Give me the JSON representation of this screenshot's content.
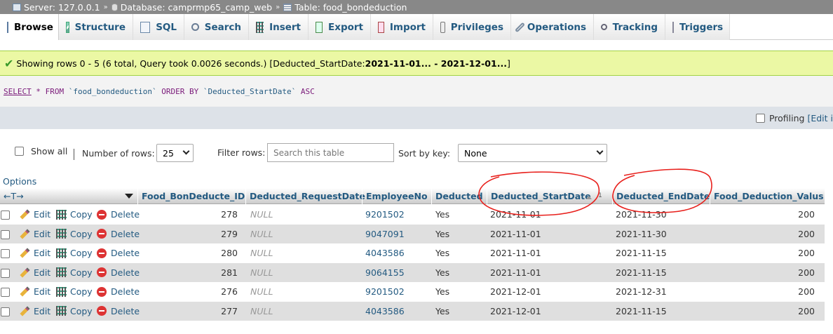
{
  "breadcrumb": {
    "server": "Server: 127.0.0.1",
    "database": "Database: camprmp65_camp_web",
    "table": "Table: food_bondeduction",
    "separator": "»"
  },
  "tabs": [
    {
      "label": "Browse",
      "icon": "browse-icon"
    },
    {
      "label": "Structure",
      "icon": "structure-icon"
    },
    {
      "label": "SQL",
      "icon": "sql-icon"
    },
    {
      "label": "Search",
      "icon": "search-icon"
    },
    {
      "label": "Insert",
      "icon": "insert-icon"
    },
    {
      "label": "Export",
      "icon": "export-icon"
    },
    {
      "label": "Import",
      "icon": "import-icon"
    },
    {
      "label": "Privileges",
      "icon": "privileges-icon"
    },
    {
      "label": "Operations",
      "icon": "operations-icon"
    },
    {
      "label": "Tracking",
      "icon": "tracking-icon"
    },
    {
      "label": "Triggers",
      "icon": "triggers-icon"
    }
  ],
  "message": {
    "text": "Showing rows 0 - 5 (6 total, Query took 0.0026 seconds.) [Deducted_StartDate: ",
    "range": "2021-11-01... - 2021-12-01...",
    "close": "]"
  },
  "sql": {
    "select": "SELECT",
    "star": "*",
    "from": "FROM",
    "table": "`food_bondeduction`",
    "orderby": "ORDER BY",
    "column": "`Deducted_StartDate`",
    "dir": "ASC"
  },
  "profiling": {
    "label": "Profiling",
    "edit_inline": "[Edit i"
  },
  "nav": {
    "show_all": "Show all",
    "number_of_rows": "Number of rows:",
    "rows_value": "25",
    "filter_rows": "Filter rows:",
    "filter_placeholder": "Search this table",
    "sort_by_key": "Sort by key:",
    "sort_value": "None"
  },
  "options_label": "Options",
  "table": {
    "toggle_label": "←T→",
    "columns": [
      "Food_BonDeducte_ID",
      "Deducted_RequestDate",
      "EmployeeNo",
      "Deducted",
      "Deducted_StartDate",
      "Deducted_EndDate",
      "Food_Deduction_Valus"
    ],
    "sort_indicator": "1",
    "actions": {
      "edit": "Edit",
      "copy": "Copy",
      "delete": "Delete"
    },
    "rows": [
      {
        "id": "278",
        "request": "NULL",
        "emp": "9201502",
        "deducted": "Yes",
        "start": "2021-11-01",
        "end": "2021-11-30",
        "value": "200"
      },
      {
        "id": "279",
        "request": "NULL",
        "emp": "9047091",
        "deducted": "Yes",
        "start": "2021-11-01",
        "end": "2021-11-30",
        "value": "200"
      },
      {
        "id": "280",
        "request": "NULL",
        "emp": "4043586",
        "deducted": "Yes",
        "start": "2021-11-01",
        "end": "2021-11-15",
        "value": "200"
      },
      {
        "id": "281",
        "request": "NULL",
        "emp": "9064155",
        "deducted": "Yes",
        "start": "2021-11-01",
        "end": "2021-11-15",
        "value": "200"
      },
      {
        "id": "276",
        "request": "NULL",
        "emp": "9201502",
        "deducted": "Yes",
        "start": "2021-12-01",
        "end": "2021-12-31",
        "value": "200"
      },
      {
        "id": "277",
        "request": "NULL",
        "emp": "4043586",
        "deducted": "Yes",
        "start": "2021-12-01",
        "end": "2021-11-15",
        "value": "200"
      }
    ]
  },
  "colors": {
    "link": "#235a81",
    "success_bg": "#ebf8a4",
    "row_alt": "#dfdfdf",
    "annotation": "#e8201c"
  }
}
